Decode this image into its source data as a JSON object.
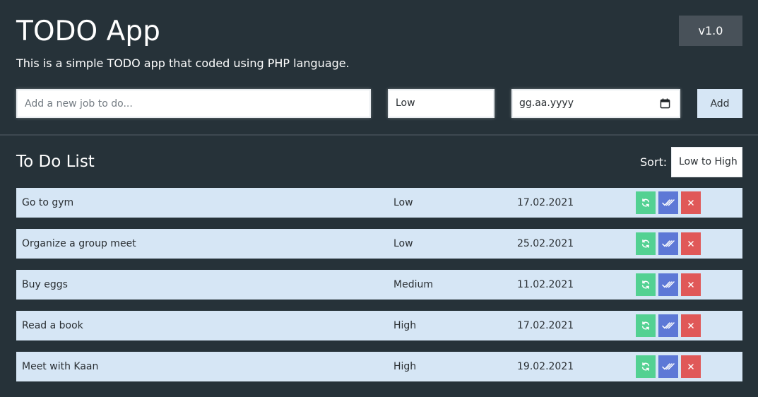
{
  "app": {
    "title": "TODO App",
    "subtitle": "This is a simple TODO app that coded using PHP language.",
    "version": "v1.0"
  },
  "form": {
    "job_placeholder": "Add a new job to do...",
    "priority_value": "Low",
    "date_value": "gg.aa.yyyy",
    "add_label": "Add"
  },
  "list": {
    "title": "To Do List",
    "sort_label": "Sort:",
    "sort_value": "Low to High",
    "items": [
      {
        "task": "Go to gym",
        "priority": "Low",
        "date": "17.02.2021"
      },
      {
        "task": "Organize a group meet",
        "priority": "Low",
        "date": "25.02.2021"
      },
      {
        "task": "Buy eggs",
        "priority": "Medium",
        "date": "11.02.2021"
      },
      {
        "task": "Read a book",
        "priority": "High",
        "date": "17.02.2021"
      },
      {
        "task": "Meet with Kaan",
        "priority": "High",
        "date": "19.02.2021"
      }
    ]
  },
  "icons": {
    "refresh": "refresh-icon",
    "done": "double-check-icon",
    "delete": "close-icon",
    "calendar": "calendar-icon"
  },
  "colors": {
    "background": "#263239",
    "row": "#d6e6f5",
    "refresh": "#53d192",
    "done": "#5d78d6",
    "delete": "#e05858",
    "version_badge": "#485159"
  }
}
